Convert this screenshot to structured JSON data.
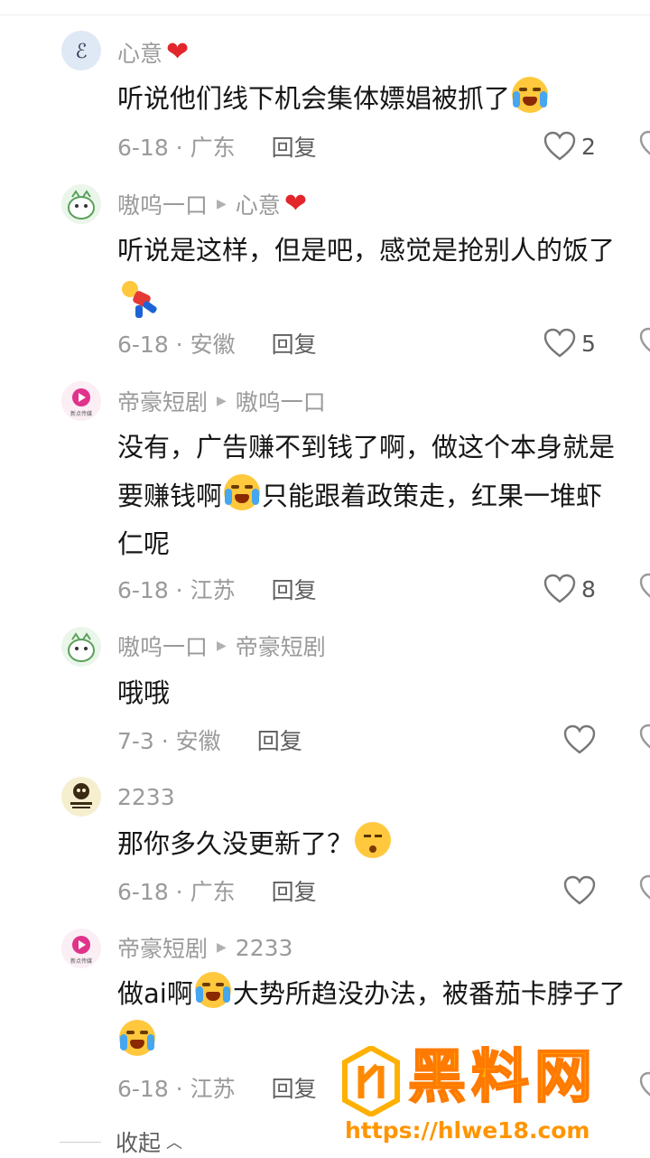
{
  "comments": [
    {
      "author": "心意",
      "author_heart": "❤",
      "reply_to": "",
      "line1": "听说他们线下机会集体嫖娼被抓了",
      "line2": "",
      "line3": "",
      "date_region": "6-18 · 广东",
      "reply_label": "回复",
      "likes": "2"
    },
    {
      "author": "嗷呜一口",
      "reply_to": "心意",
      "reply_to_heart": "❤",
      "line1": "听说是这样，但是吧，感觉是抢别人的饭了",
      "line2": "",
      "date_region": "6-18 · 安徽",
      "reply_label": "回复",
      "likes": "5"
    },
    {
      "author": "帝豪短剧",
      "reply_to": "嗷呜一口",
      "line1": "没有，广告赚不到钱了啊，做这个本身就是",
      "line2_a": "要赚钱啊",
      "line2_b": "只能跟着政策走，红果一堆虾",
      "line3": "仁呢",
      "date_region": "6-18 · 江苏",
      "reply_label": "回复",
      "likes": "8"
    },
    {
      "author": "嗷呜一口",
      "reply_to": "帝豪短剧",
      "line1": "哦哦",
      "date_region": "7-3 · 安徽",
      "reply_label": "回复",
      "likes": ""
    },
    {
      "author": "2233",
      "reply_to": "",
      "line1": "那你多久没更新了？",
      "date_region": "6-18 · 广东",
      "reply_label": "回复",
      "likes": ""
    },
    {
      "author": "帝豪短剧",
      "reply_to": "2233",
      "line1_a": "做ai啊",
      "line1_b": "大势所趋没办法，被番茄卡脖子了",
      "date_region": "6-18 · 江苏",
      "reply_label": "回复",
      "likes": ""
    }
  ],
  "collapse_label": "收起",
  "watermark": {
    "title": "黑料网",
    "url": "https://hlwe18.com"
  },
  "colors": {
    "heart_red": "#e2262b",
    "meta_gray": "#9a9a9a",
    "watermark_orange": "#ffb000"
  }
}
